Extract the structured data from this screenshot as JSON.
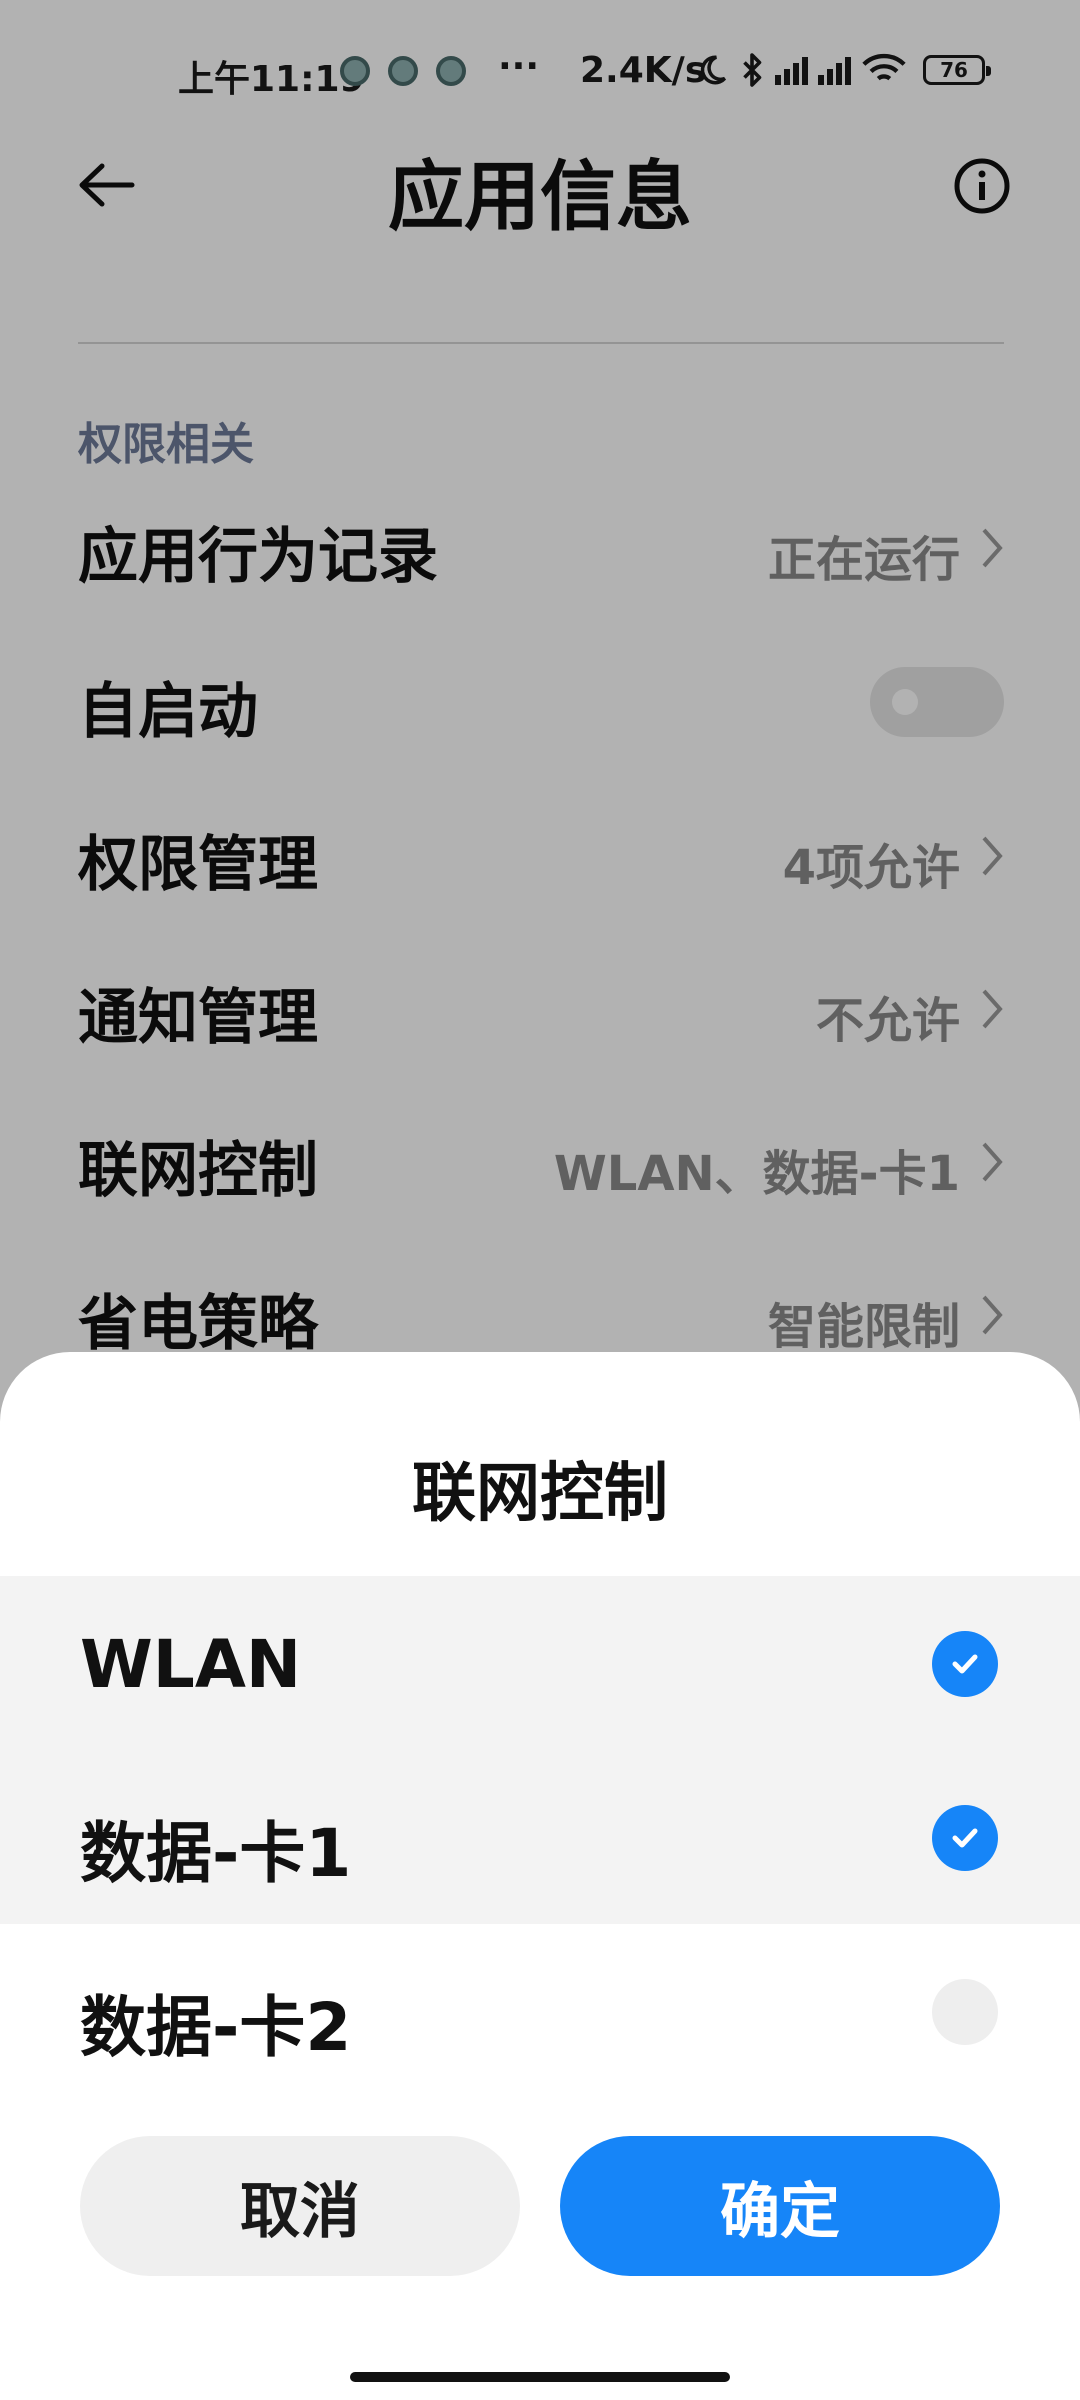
{
  "status_bar": {
    "time": "上午11:19",
    "more": "···",
    "net_speed": "2.4K/s",
    "battery": "76",
    "icons": [
      "notification-icon",
      "notification-icon",
      "notification-icon",
      "moon-icon",
      "bluetooth-icon",
      "hd-signal-icon",
      "hd-signal-icon",
      "wifi-icon",
      "battery-icon"
    ]
  },
  "header": {
    "title": "应用信息",
    "back_icon": "back-arrow-icon",
    "info_icon": "info-icon"
  },
  "section_label": "权限相关",
  "settings": [
    {
      "label": "应用行为记录",
      "value": "正在运行"
    },
    {
      "label": "自启动",
      "toggle": false
    },
    {
      "label": "权限管理",
      "value": "4项允许"
    },
    {
      "label": "通知管理",
      "value": "不允许"
    },
    {
      "label": "联网控制",
      "value": "WLAN、数据-卡1"
    },
    {
      "label": "省电策略",
      "value": "智能限制"
    }
  ],
  "sheet": {
    "title": "联网控制",
    "options": [
      {
        "label": "WLAN",
        "checked": true
      },
      {
        "label": "数据-卡1",
        "checked": true
      },
      {
        "label": "数据-卡2",
        "checked": false
      }
    ],
    "cancel_label": "取消",
    "ok_label": "确定"
  },
  "colors": {
    "accent": "#1685f8",
    "section_label": "#6d7a99",
    "value_text": "#8a8a8a"
  }
}
